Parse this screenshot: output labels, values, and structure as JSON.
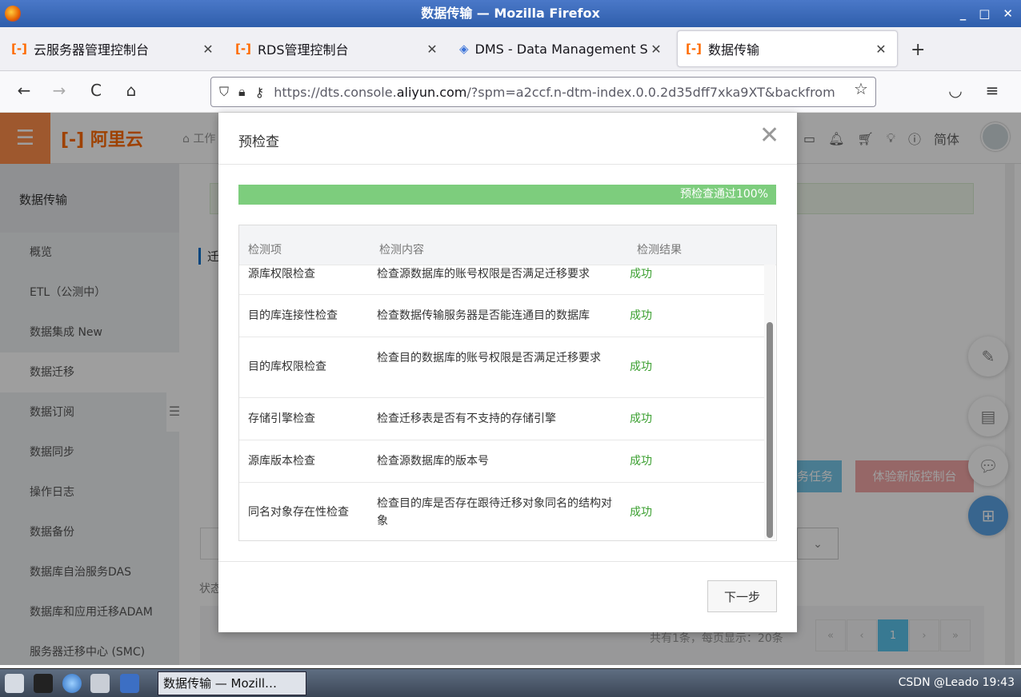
{
  "window": {
    "title": "数据传输 — Mozilla Firefox",
    "controls": [
      "_",
      "□",
      "✕"
    ]
  },
  "tabs": [
    {
      "label": "云服务器管理控制台",
      "icon": "[-]",
      "close": "✕"
    },
    {
      "label": "RDS管理控制台",
      "icon": "[-]",
      "close": "✕"
    },
    {
      "label": "DMS - Data Management Se",
      "icon": "◈",
      "close": "✕"
    },
    {
      "label": "数据传输",
      "icon": "[-]",
      "close": "✕"
    }
  ],
  "newtab": "+",
  "nav": {
    "back": "←",
    "forward": "→",
    "reload": "C",
    "home": "⌂",
    "url_prefix": "https://dts.console.",
    "url_domain": "aliyun.com",
    "url_suffix": "/?spm=a2ccf.n-dtm-index.0.0.2d35dff7xka9XT&backfrom",
    "bookmark": "☆",
    "pocket": "◡",
    "menu": "≡"
  },
  "header": {
    "logo": "[-] 阿里云",
    "breadcrumb": "⌂ 工作",
    "lang": "简体",
    "menu_icon": "☰"
  },
  "sidebar": {
    "title": "数据传输",
    "items": [
      {
        "label": "概览"
      },
      {
        "label": "ETL（公测中）"
      },
      {
        "label": "数据集成  New"
      },
      {
        "label": "数据迁移"
      },
      {
        "label": "数据订阅"
      },
      {
        "label": "数据同步"
      },
      {
        "label": "操作日志"
      },
      {
        "label": "数据备份"
      },
      {
        "label": "数据库自治服务DAS"
      },
      {
        "label": "数据库和应用迁移ADAM"
      },
      {
        "label": "服务器迁移中心 (SMC)"
      }
    ],
    "toggle": "☰"
  },
  "main": {
    "section_title": "迁",
    "task_btn": "务任务",
    "new_console_btn": "体验新版控制台",
    "status_label": "状态",
    "pager_info": "共有1条，每页显示：20条",
    "pager": [
      "«",
      "‹",
      "1",
      "›",
      "»"
    ],
    "select_arrow": "⌄"
  },
  "modal": {
    "title": "预检查",
    "close": "✕",
    "progress": {
      "percent": 100,
      "label": "预检查通过100%"
    },
    "columns": [
      "检测项",
      "检测内容",
      "检测结果"
    ],
    "rows": [
      {
        "item": "源库权限检查",
        "content": "检查源数据库的账号权限是否满足迁移要求",
        "result": "成功"
      },
      {
        "item": "目的库连接性检查",
        "content": "检查数据传输服务器是否能连通目的数据库",
        "result": "成功"
      },
      {
        "item": "目的库权限检查",
        "content": "检查目的数据库的账号权限是否满足迁移要求",
        "result": "成功"
      },
      {
        "item": "存储引擎检查",
        "content": "检查迁移表是否有不支持的存储引擎",
        "result": "成功"
      },
      {
        "item": "源库版本检查",
        "content": "检查源数据库的版本号",
        "result": "成功"
      },
      {
        "item": "同名对象存在性检查",
        "content": "检查目的库是否存在跟待迁移对象同名的结构对象",
        "result": "成功"
      }
    ],
    "next_button": "下一步"
  },
  "taskbar": {
    "task_label": "数据传输 — Mozill…",
    "right_text": "CSDN @Leado 19:43"
  }
}
